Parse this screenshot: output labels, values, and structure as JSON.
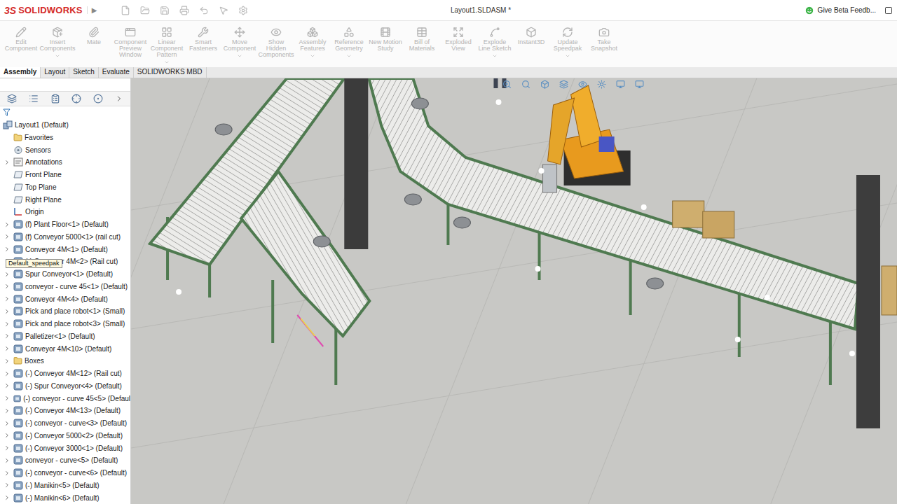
{
  "app": {
    "brand_mark": "3S",
    "brand": "SOLIDWORKS",
    "arrow": "▶"
  },
  "window": {
    "title": "Layout1.SLDASM *",
    "feedback": "Give Beta Feedb..."
  },
  "commands": [
    {
      "label": "Edit Component",
      "disabled": true,
      "menu": false
    },
    {
      "label": "Insert Components",
      "disabled": true,
      "menu": true
    },
    {
      "label": "Mate",
      "disabled": true,
      "menu": false
    },
    {
      "label": "Component Preview Window",
      "disabled": true,
      "menu": false
    },
    {
      "label": "Linear Component Pattern",
      "disabled": true,
      "menu": true
    },
    {
      "label": "Smart Fasteners",
      "disabled": true,
      "menu": false
    },
    {
      "label": "Move Component",
      "disabled": true,
      "menu": true
    },
    {
      "label": "Show Hidden Components",
      "disabled": true,
      "menu": false
    },
    {
      "label": "Assembly Features",
      "disabled": true,
      "menu": true
    },
    {
      "label": "Reference Geometry",
      "disabled": true,
      "menu": true
    },
    {
      "label": "New Motion Study",
      "disabled": true,
      "menu": false
    },
    {
      "label": "Bill of Materials",
      "disabled": true,
      "menu": false
    },
    {
      "label": "Exploded View",
      "disabled": true,
      "menu": false
    },
    {
      "label": "Explode Line Sketch",
      "disabled": true,
      "menu": true
    },
    {
      "label": "Instant3D",
      "disabled": true,
      "menu": false
    },
    {
      "label": "Update Speedpak",
      "disabled": true,
      "menu": true
    },
    {
      "label": "Take Snapshot",
      "disabled": true,
      "menu": false
    }
  ],
  "tabs": [
    {
      "label": "Assembly",
      "selected": true
    },
    {
      "label": "Layout",
      "selected": false
    },
    {
      "label": "Sketch",
      "selected": false
    },
    {
      "label": "Evaluate",
      "selected": false
    },
    {
      "label": "SOLIDWORKS MBD",
      "selected": false
    }
  ],
  "tree": [
    {
      "label": "Layout1  (Default)",
      "kind": "root",
      "has_children": false
    },
    {
      "label": "Favorites",
      "kind": "folder",
      "has_children": false
    },
    {
      "label": "Sensors",
      "kind": "sensor",
      "has_children": false
    },
    {
      "label": "Annotations",
      "kind": "annotation",
      "has_children": true
    },
    {
      "label": "Front Plane",
      "kind": "plane",
      "has_children": false
    },
    {
      "label": "Top Plane",
      "kind": "plane",
      "has_children": false
    },
    {
      "label": "Right Plane",
      "kind": "plane",
      "has_children": false
    },
    {
      "label": "Origin",
      "kind": "origin",
      "has_children": false
    },
    {
      "label": "(f) Plant Floor<1> (Default)",
      "kind": "part",
      "has_children": true
    },
    {
      "label": "(f) Conveyor 5000<1> (rail cut)",
      "kind": "part",
      "has_children": true
    },
    {
      "label": "Conveyor 4M<1> (Default)",
      "kind": "part",
      "has_children": true
    },
    {
      "label": "(-) Conveyor 4M<2> (Rail cut)",
      "kind": "part",
      "has_children": true,
      "tooltip": "Default_speedpak"
    },
    {
      "label": "Spur Conveyor<1> (Default)",
      "kind": "part",
      "has_children": true
    },
    {
      "label": "conveyor - curve 45<1> (Default)",
      "kind": "part",
      "has_children": true
    },
    {
      "label": "Conveyor 4M<4> (Default)",
      "kind": "part",
      "has_children": true
    },
    {
      "label": "Pick and place robot<1> (Small)",
      "kind": "part",
      "has_children": true
    },
    {
      "label": "Pick and place robot<3> (Small)",
      "kind": "part",
      "has_children": true
    },
    {
      "label": "Palletizer<1> (Default)",
      "kind": "part",
      "has_children": true
    },
    {
      "label": "Conveyor 4M<10> (Default)",
      "kind": "part",
      "has_children": true
    },
    {
      "label": "Boxes",
      "kind": "folder",
      "has_children": true
    },
    {
      "label": "(-) Conveyor 4M<12> (Rail cut)",
      "kind": "part",
      "has_children": true
    },
    {
      "label": "(-) Spur Conveyor<4> (Default)",
      "kind": "part",
      "has_children": true
    },
    {
      "label": "(-) conveyor - curve 45<5> (Defaul",
      "kind": "part",
      "has_children": true
    },
    {
      "label": "(-) Conveyor 4M<13> (Default)",
      "kind": "part",
      "has_children": true
    },
    {
      "label": "(-) conveyor - curve<3> (Default)",
      "kind": "part",
      "has_children": true
    },
    {
      "label": "(-) Conveyor 5000<2> (Default)",
      "kind": "part",
      "has_children": true
    },
    {
      "label": "(-) Conveyor 3000<1> (Default)",
      "kind": "part",
      "has_children": true
    },
    {
      "label": "conveyor - curve<5> (Default)",
      "kind": "part",
      "has_children": true
    },
    {
      "label": "(-) conveyor - curve<6> (Default)",
      "kind": "part",
      "has_children": true
    },
    {
      "label": "(-) Manikin<5> (Default)",
      "kind": "part",
      "has_children": true
    },
    {
      "label": "(-) Manikin<6> (Default)",
      "kind": "part",
      "has_children": true
    }
  ]
}
